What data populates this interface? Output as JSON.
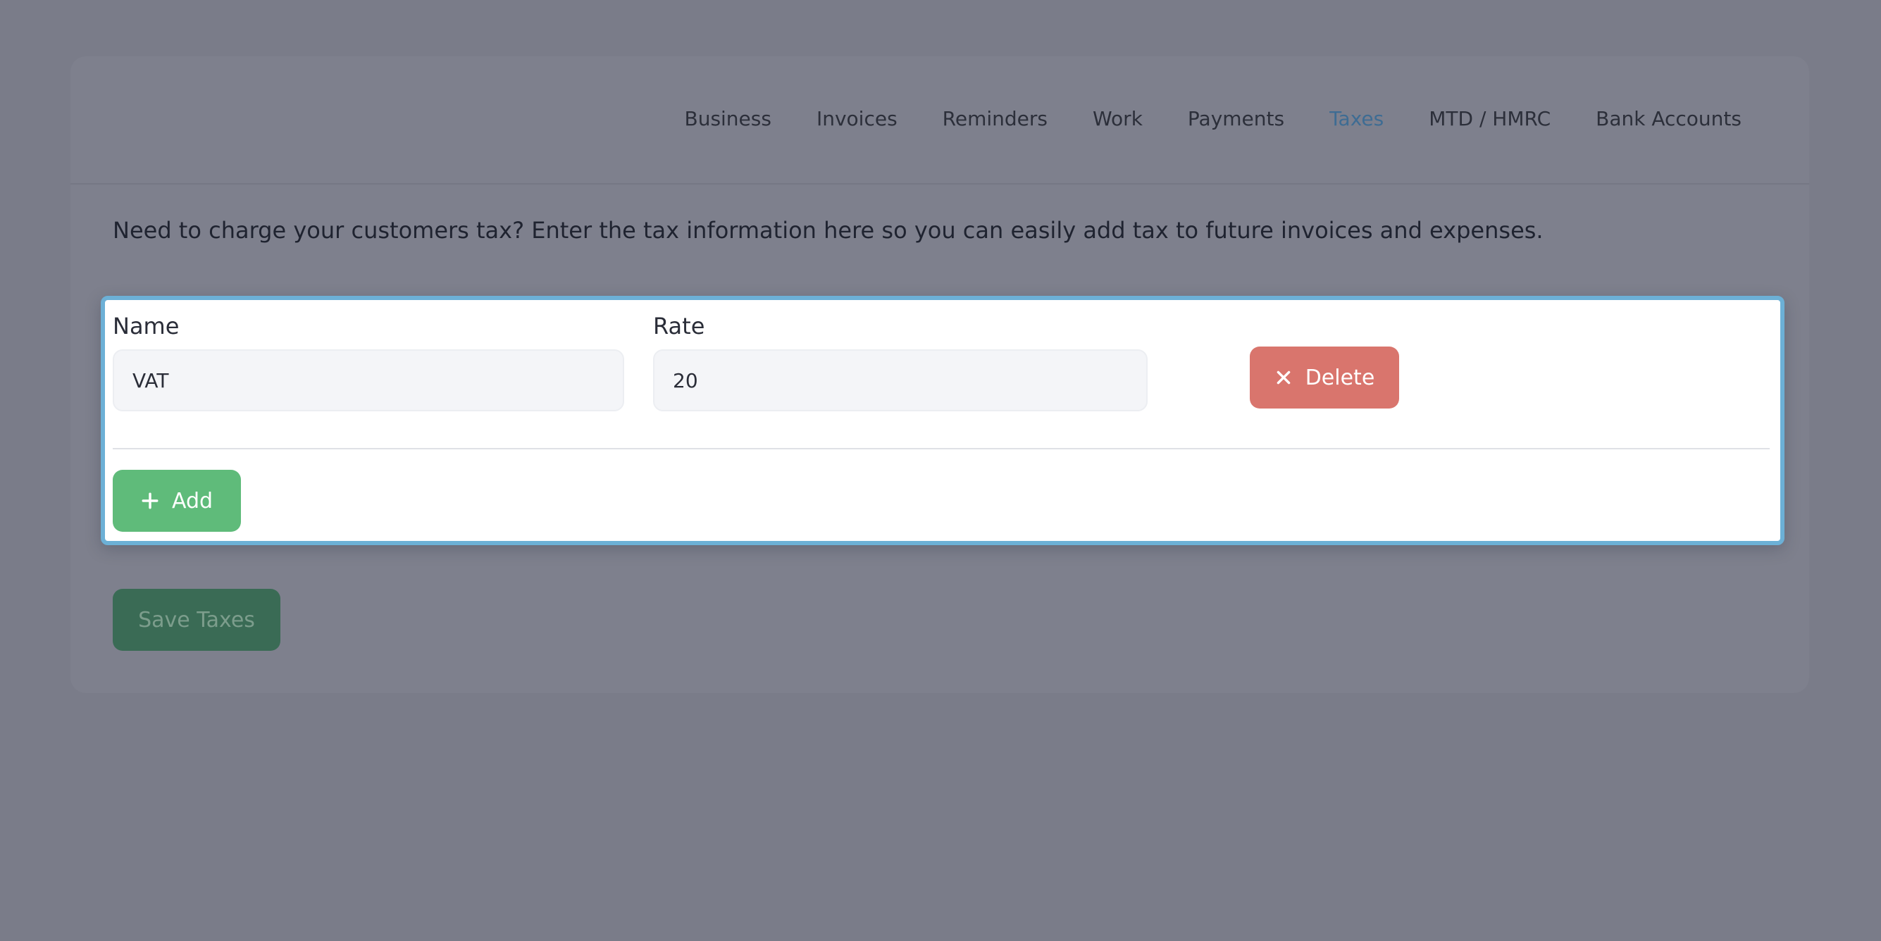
{
  "nav": {
    "items": [
      {
        "label": "Business"
      },
      {
        "label": "Invoices"
      },
      {
        "label": "Reminders"
      },
      {
        "label": "Work"
      },
      {
        "label": "Payments"
      },
      {
        "label": "Taxes",
        "active": true
      },
      {
        "label": "MTD / HMRC"
      },
      {
        "label": "Bank Accounts"
      }
    ]
  },
  "intro": "Need to charge your customers tax? Enter the tax information here so you can easily add tax to future invoices and expenses.",
  "taxes": {
    "name_label": "Name",
    "rate_label": "Rate",
    "rows": [
      {
        "name": "VAT",
        "rate": "20"
      }
    ],
    "delete_label": "Delete",
    "delete_icon": "close-icon",
    "add_label": "Add",
    "add_icon": "plus-icon"
  },
  "save_label": "Save Taxes",
  "colors": {
    "accent_active": "#3e6c93",
    "delete": "#d9756d",
    "add": "#5fbb7a",
    "save": "#3a6b55",
    "panel_border": "#6cb0d6"
  }
}
